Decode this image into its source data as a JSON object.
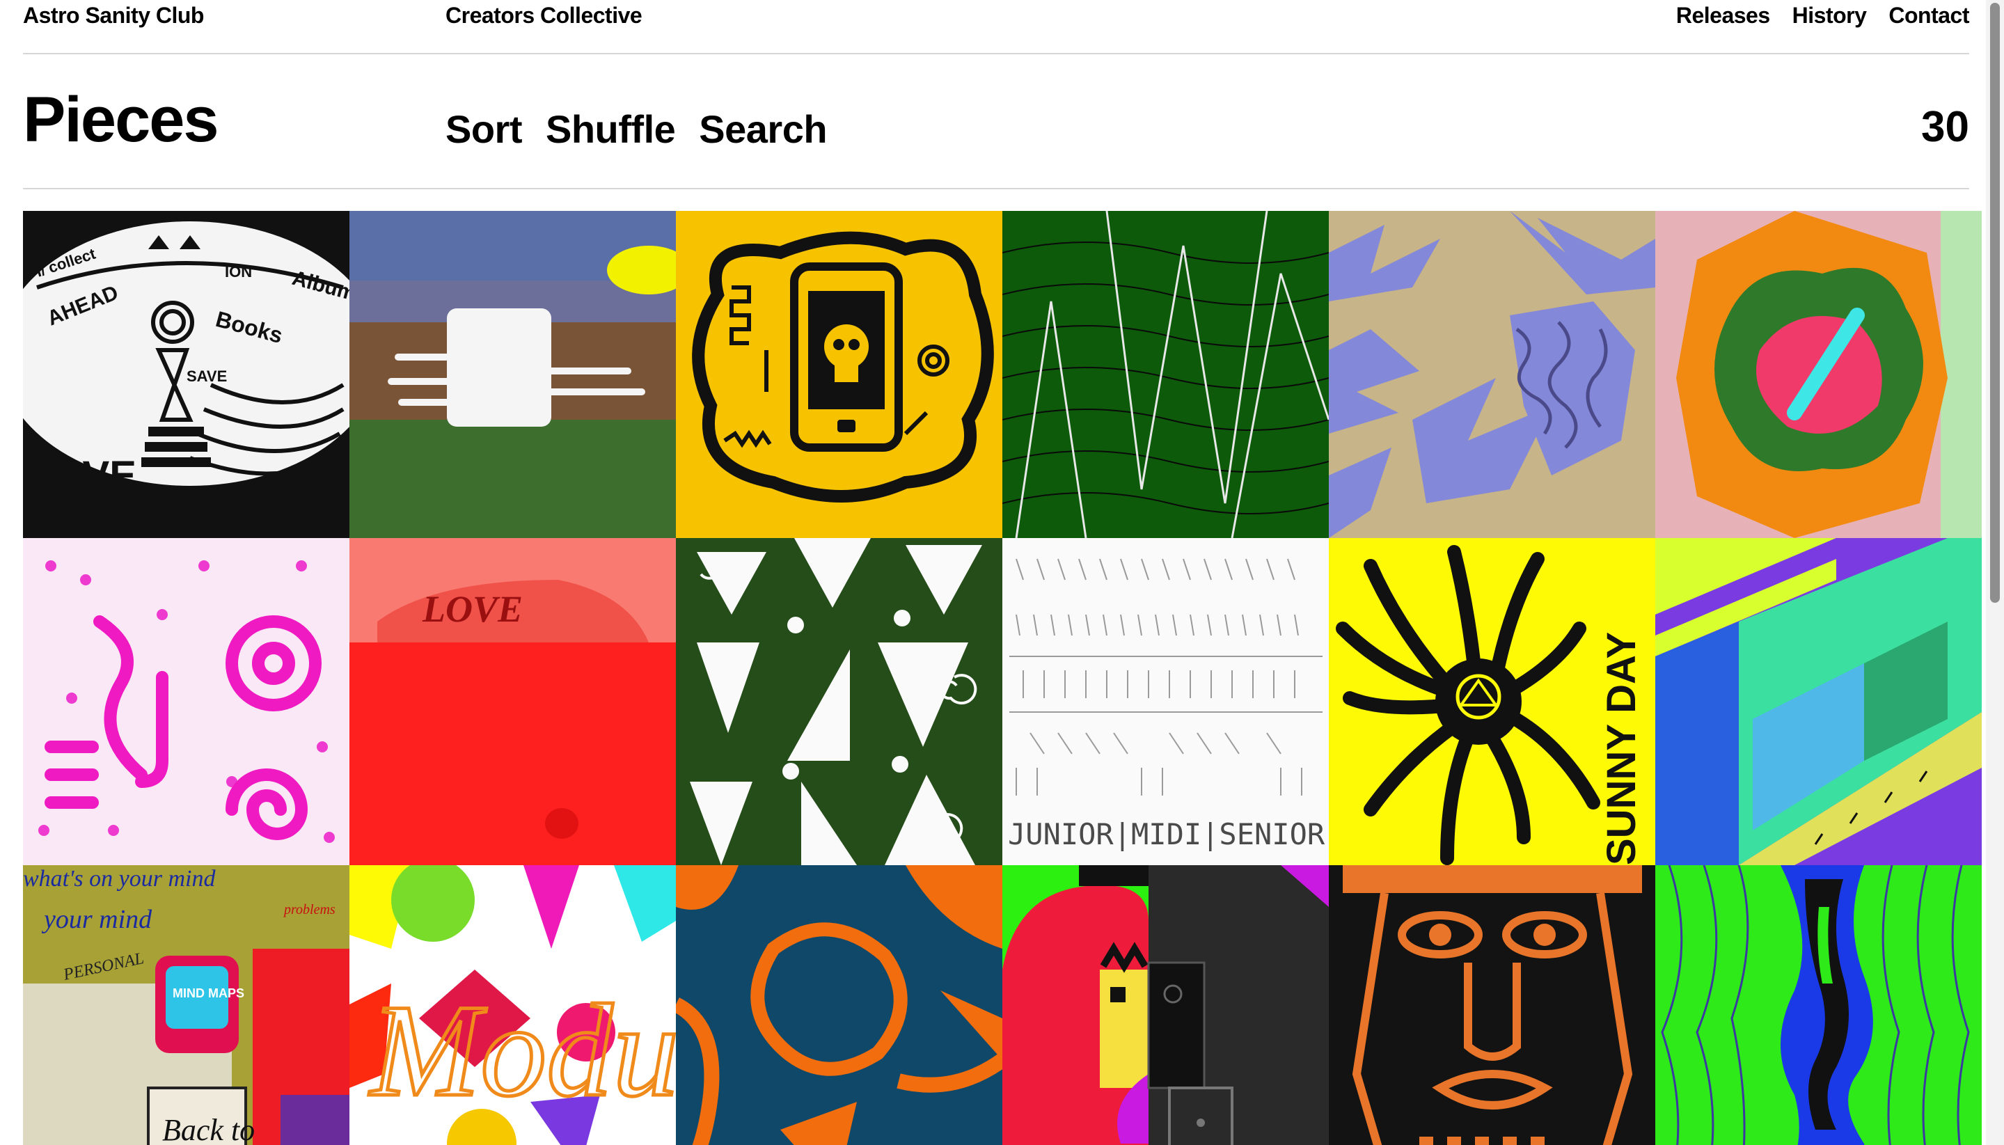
{
  "header": {
    "brand": "Astro Sanity Club",
    "collective": "Creators Collective",
    "nav": [
      "Releases",
      "History",
      "Contact"
    ]
  },
  "heading": {
    "title": "Pieces",
    "tools": [
      "Sort",
      "Shuffle",
      "Search"
    ],
    "count": "30"
  },
  "pieces": [
    {
      "name": "hourglass-books-drawing",
      "text": [
        "I/ collect",
        "ION",
        "Albums",
        "AHEAD",
        "Books",
        "SAVE",
        "LOVE"
      ]
    },
    {
      "name": "white-square-landscape"
    },
    {
      "name": "yellow-phone-skull"
    },
    {
      "name": "green-zigzag-lines"
    },
    {
      "name": "lavender-tan-shapes"
    },
    {
      "name": "pink-orange-green-blob"
    },
    {
      "name": "pink-dots-spiral"
    },
    {
      "name": "red-love-car",
      "text": [
        "LOVE"
      ]
    },
    {
      "name": "green-white-triangles"
    },
    {
      "name": "white-junior-midi-senior",
      "text": [
        "JUNIOR|MIDI|SENIOR"
      ]
    },
    {
      "name": "yellow-black-spider",
      "text": [
        "SUNNY DAY"
      ]
    },
    {
      "name": "purple-green-perspective"
    },
    {
      "name": "mind-map-collage",
      "text": [
        "what's on your mind",
        "your mind",
        "PERSONAL",
        "MIND MAPS",
        "Back to",
        "problems"
      ]
    },
    {
      "name": "colorful-shapes-module",
      "text": [
        "Modul"
      ]
    },
    {
      "name": "orange-navy-figure"
    },
    {
      "name": "split-red-black-faces"
    },
    {
      "name": "orange-black-mask"
    },
    {
      "name": "green-blue-squiggle"
    }
  ],
  "colors": {
    "divider": "#d6d6d6",
    "text": "#000000",
    "background": "#ffffff"
  }
}
